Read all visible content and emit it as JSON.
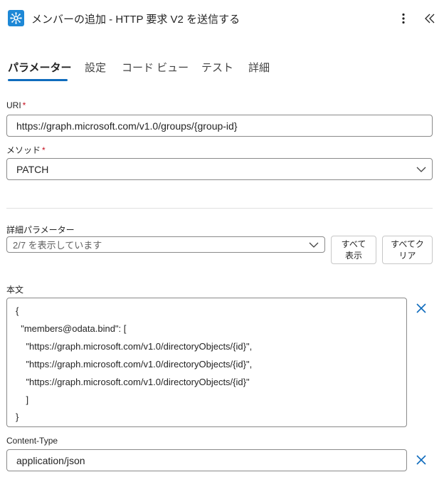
{
  "header": {
    "title": "メンバーの追加 - HTTP 要求 V2 を送信する",
    "app_icon": "network-icon",
    "more_icon": "more-vertical-icon",
    "collapse_icon": "double-chevron-left-icon"
  },
  "tabs": [
    {
      "label": "パラメーター",
      "active": true
    },
    {
      "label": "設定"
    },
    {
      "label": "コード ビュー"
    },
    {
      "label": "テスト"
    },
    {
      "label": "詳細"
    }
  ],
  "uri": {
    "label": "URI",
    "required_mark": "*",
    "value": "https://graph.microsoft.com/v1.0/groups/{group-id}"
  },
  "method": {
    "label": "メソッド",
    "required_mark": "*",
    "value": "PATCH"
  },
  "advanced": {
    "label": "詳細パラメーター",
    "dropdown_value": "2/7 を表示しています",
    "show_all_line1": "すべて",
    "show_all_line2": "表示",
    "clear_all_line1": "すべてク",
    "clear_all_line2": "リア"
  },
  "body": {
    "label": "本文",
    "lines": [
      "{",
      "  \"members@odata.bind\": [",
      "    \"https://graph.microsoft.com/v1.0/directoryObjects/{id}\",",
      "    \"https://graph.microsoft.com/v1.0/directoryObjects/{id}\",",
      "    \"https://graph.microsoft.com/v1.0/directoryObjects/{id}\"",
      "    ]",
      "}"
    ]
  },
  "content_type": {
    "label": "Content-Type",
    "value": "application/json"
  },
  "colors": {
    "accent": "#0f6cbd",
    "required": "#c50f1f",
    "icon_bg": "#1e88d6"
  }
}
